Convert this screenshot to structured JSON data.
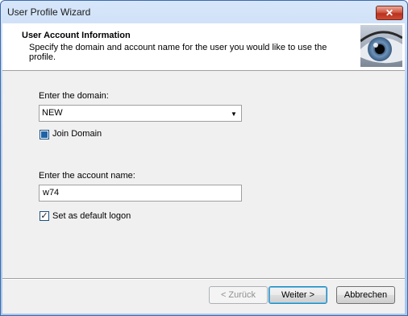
{
  "window": {
    "title": "User Profile Wizard"
  },
  "header": {
    "title": "User Account  Information",
    "subtitle": "Specify the domain and account name for the user you would like to use the profile."
  },
  "domain": {
    "label": "Enter the domain:",
    "value": "NEW"
  },
  "join_domain": {
    "label": "Join Domain",
    "state": "indeterminate"
  },
  "account": {
    "label": "Enter the account name:",
    "value": "w74"
  },
  "default_logon": {
    "label": "Set as default logon",
    "checked": true
  },
  "buttons": {
    "back": "< Zurück",
    "next": "Weiter >",
    "cancel": "Abbrechen"
  },
  "colors": {
    "title_bar": "#bcd3f1",
    "close_button": "#c8442f",
    "dialog_bg": "#f0f0f0",
    "checkbox_fill": "#1f63a6"
  },
  "icons": {
    "close": "close-icon",
    "dropdown": "chevron-down-icon",
    "checkmark": "checkmark-icon",
    "header_image": "eye-image"
  }
}
